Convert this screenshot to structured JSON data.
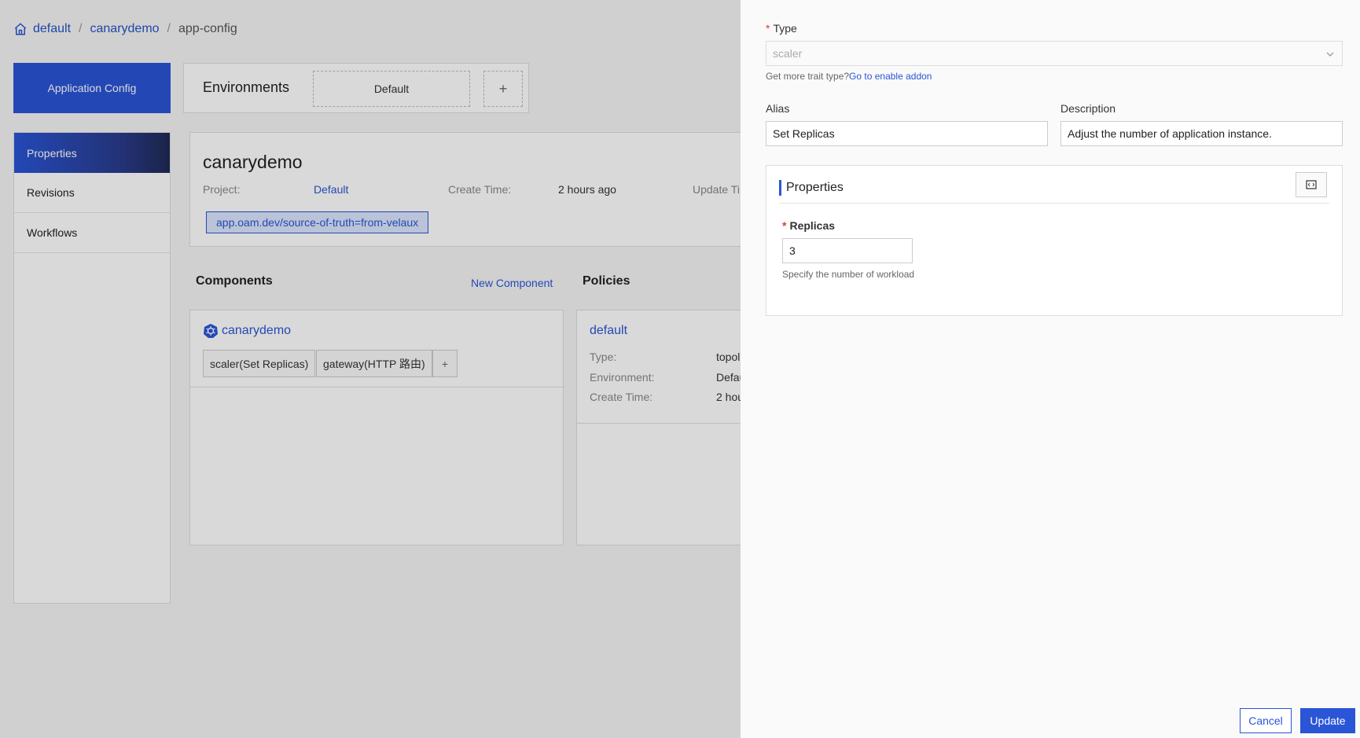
{
  "breadcrumb": {
    "items": [
      "default",
      "canarydemo"
    ],
    "current": "app-config"
  },
  "app_config_label": "Application Config",
  "environments": {
    "title": "Environments",
    "default_label": "Default",
    "add_label": "+"
  },
  "sidenav": {
    "items": [
      "Properties",
      "Revisions",
      "Workflows"
    ]
  },
  "app": {
    "name": "canarydemo",
    "project_label": "Project:",
    "project_value": "Default",
    "create_time_label": "Create Time:",
    "create_time_value": "2 hours ago",
    "update_time_label": "Update Ti",
    "label_tag": "app.oam.dev/source-of-truth=from-velaux"
  },
  "components": {
    "title": "Components",
    "new_label": "New Component",
    "item_name": "canarydemo",
    "traits": [
      "scaler(Set Replicas)",
      "gateway(HTTP 路由)"
    ],
    "add_trait_label": "+"
  },
  "policies": {
    "title": "Policies",
    "item_name": "default",
    "type_label": "Type:",
    "type_value": "topol",
    "env_label": "Environment:",
    "env_value": "Defau",
    "create_label": "Create Time:",
    "create_value": "2 hou"
  },
  "drawer": {
    "type_label": "Type",
    "type_value": "scaler",
    "type_hint_prefix": "Get more trait type?",
    "type_hint_link": "Go to enable addon",
    "alias_label": "Alias",
    "alias_value": "Set Replicas",
    "description_label": "Description",
    "description_value": "Adjust the number of application instance.",
    "properties_title": "Properties",
    "replicas_label": "Replicas",
    "replicas_value": "3",
    "replicas_hint": "Specify the number of workload",
    "cancel_label": "Cancel",
    "update_label": "Update"
  },
  "colors": {
    "accent": "#2a55d6",
    "required": "#e5372a"
  }
}
